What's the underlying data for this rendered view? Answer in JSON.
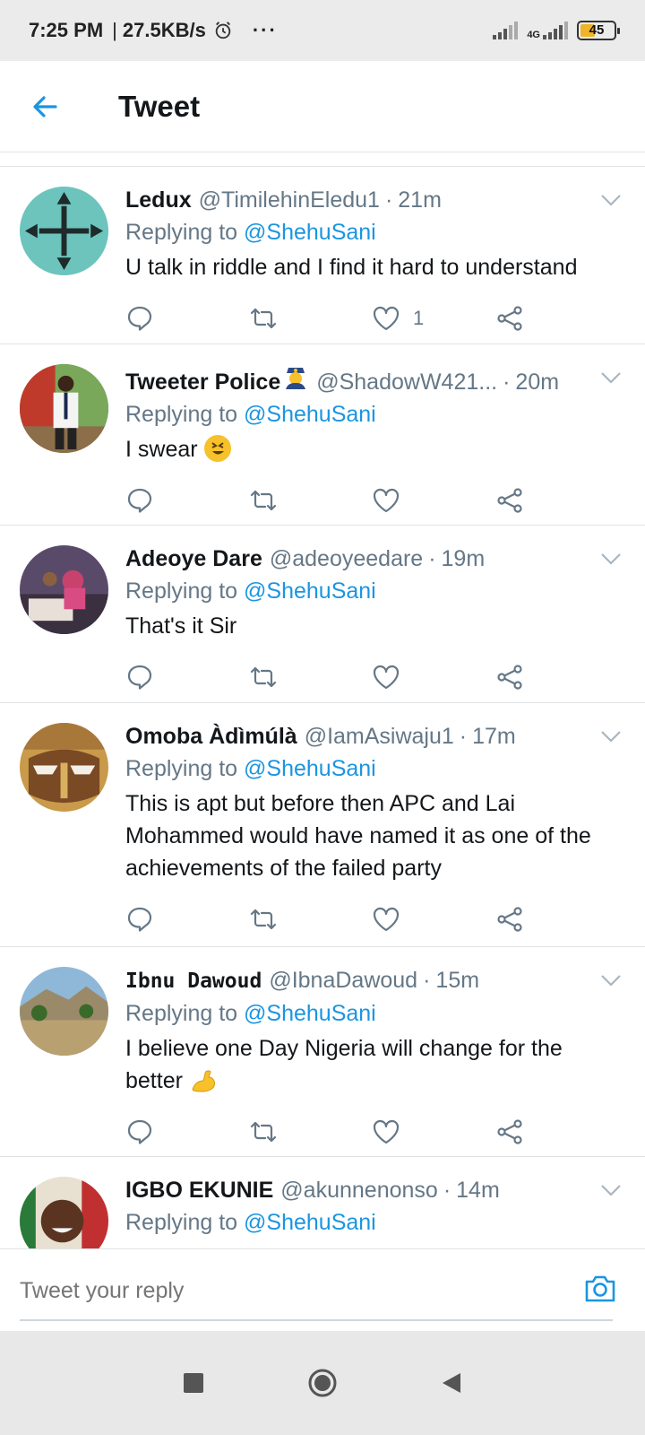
{
  "status_bar": {
    "time": "7:25 PM",
    "speed": "27.5KB/s",
    "network_label": "4G",
    "battery_level": "45",
    "more_label": "···"
  },
  "header": {
    "title": "Tweet"
  },
  "tweets": [
    {
      "name": "Ledux",
      "handle": "@TimilehinEledu1",
      "time": "21m",
      "replying_prefix": "Replying to",
      "replying_to": "@ShehuSani",
      "text": "U talk in riddle and I find it hard to understand",
      "like_count": "1"
    },
    {
      "name": "Tweeter Police",
      "handle": "@ShadowW421...",
      "time": "20m",
      "replying_prefix": "Replying to",
      "replying_to": "@ShehuSani",
      "text": "I swear",
      "like_count": ""
    },
    {
      "name": "Adeoye Dare",
      "handle": "@adeoyeedare",
      "time": "19m",
      "replying_prefix": "Replying to",
      "replying_to": "@ShehuSani",
      "text": "That's it Sir",
      "like_count": ""
    },
    {
      "name": "Omoba Àdìmúlà",
      "handle": "@IamAsiwaju1",
      "time": "17m",
      "replying_prefix": "Replying to",
      "replying_to": "@ShehuSani",
      "text": "This is apt but before then APC and Lai Mohammed would have named it as one of the achievements of the failed party",
      "like_count": ""
    },
    {
      "name": "Ibnu Dawoud",
      "handle": "@IbnaDawoud",
      "time": "15m",
      "replying_prefix": "Replying to",
      "replying_to": "@ShehuSani",
      "text": "I believe one Day Nigeria will change for the better",
      "like_count": ""
    },
    {
      "name": "IGBO EKUNIE",
      "handle": "@akunnenonso",
      "time": "14m",
      "replying_prefix": "Replying to",
      "replying_to": "@ShehuSani",
      "text": "",
      "like_count": ""
    }
  ],
  "reply_bar": {
    "placeholder": "Tweet your reply"
  },
  "colors": {
    "accent": "#1b95e0",
    "muted": "#657786",
    "text": "#14171a",
    "divider": "#dfe3e6"
  },
  "icons": [
    "back-arrow-icon",
    "chevron-down-icon",
    "reply-icon",
    "retweet-icon",
    "like-icon",
    "share-icon",
    "camera-icon",
    "stop-icon",
    "home-icon",
    "back-icon"
  ]
}
